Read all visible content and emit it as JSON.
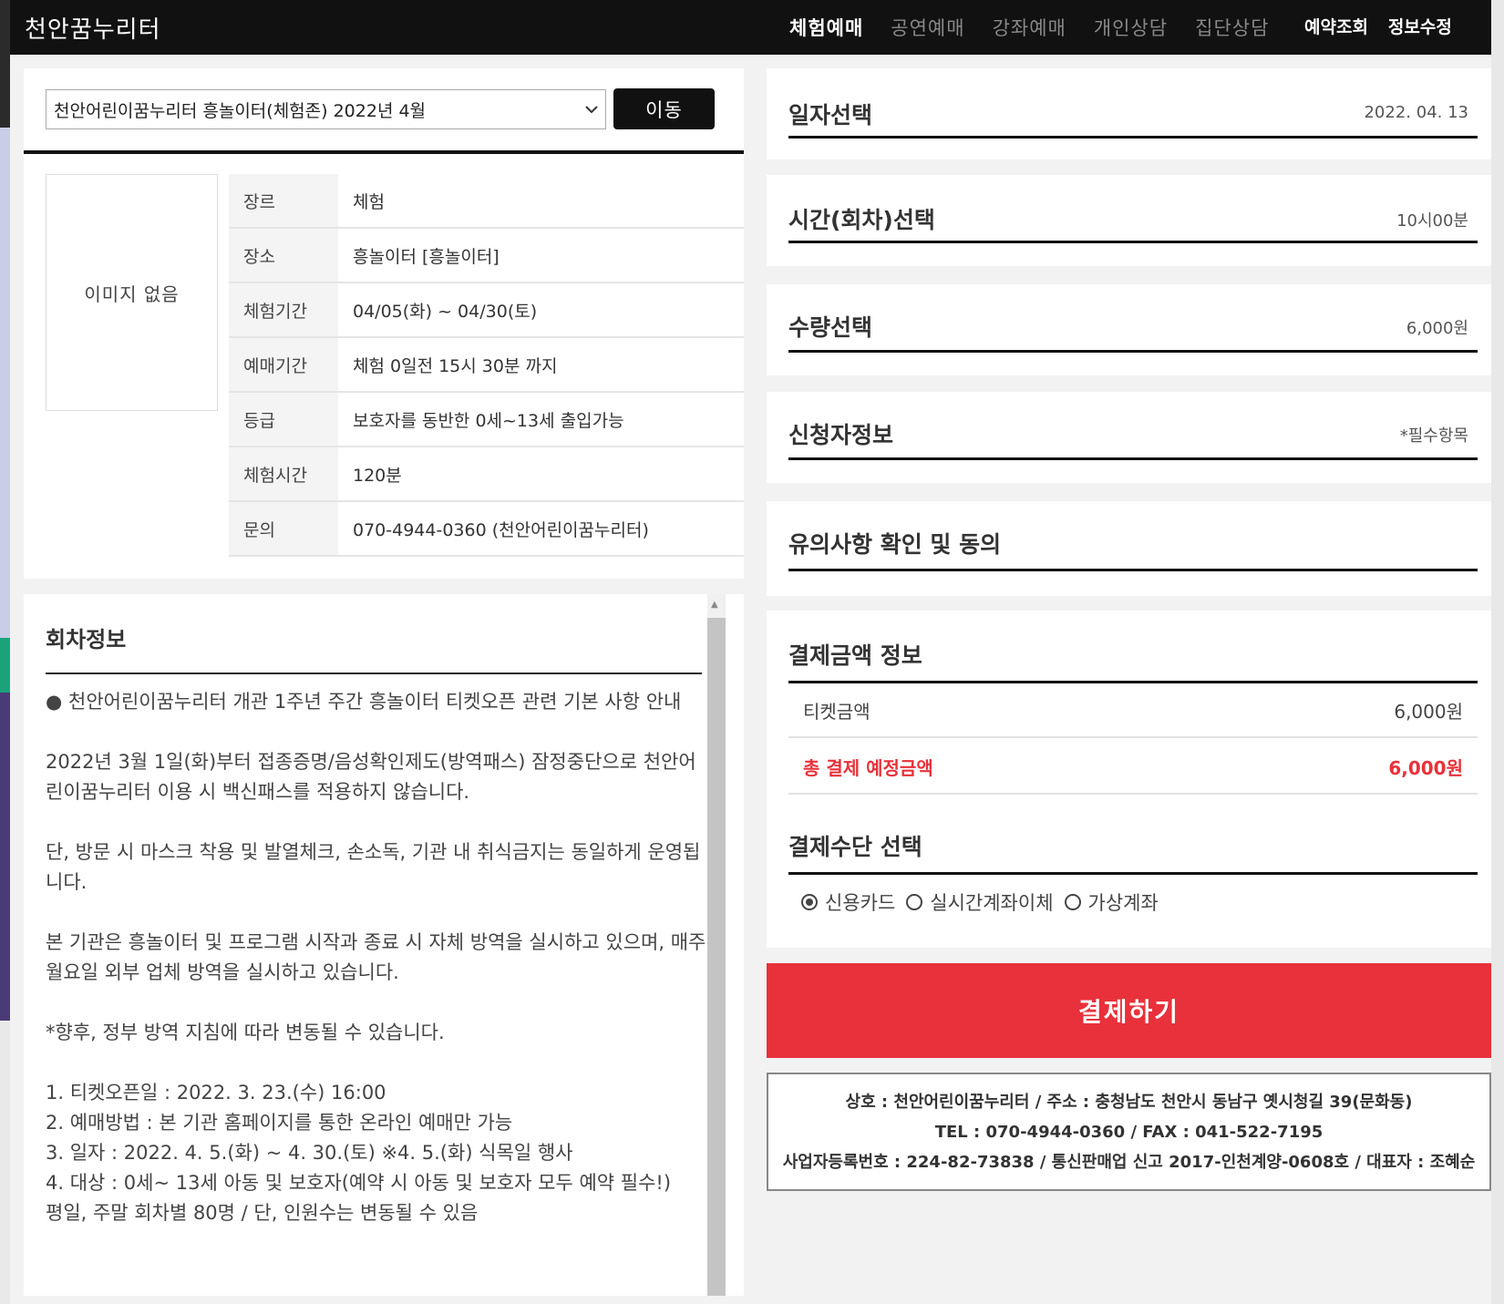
{
  "header": {
    "brand": "천안꿈누리터",
    "nav": [
      "체험예매",
      "공연예매",
      "강좌예매",
      "개인상담",
      "집단상담"
    ],
    "nav_right": [
      "예약조회",
      "정보수정"
    ]
  },
  "selector": {
    "selected": "천안어린이꿈누리터 흥놀이터(체험존) 2022년 4월",
    "button": "이동"
  },
  "no_image": "이미지 없음",
  "info": [
    {
      "k": "장르",
      "v": "체험"
    },
    {
      "k": "장소",
      "v": "흥놀이터 [흥놀이터]"
    },
    {
      "k": "체험기간",
      "v": "04/05(화) ~ 04/30(토)"
    },
    {
      "k": "예매기간",
      "v": "체험 0일전 15시 30분 까지"
    },
    {
      "k": "등급",
      "v": "보호자를 동반한 0세~13세 출입가능"
    },
    {
      "k": "체험시간",
      "v": "120분"
    },
    {
      "k": "문의",
      "v": "070-4944-0360 (천안어린이꿈누리터)"
    }
  ],
  "session": {
    "title": "회차정보",
    "p1": "● 천안어린이꿈누리터 개관 1주년 주간 흥놀이터 티켓오픈 관련 기본 사항 안내",
    "p2": "2022년 3월 1일(화)부터 접종증명/음성확인제도(방역패스) 잠정중단으로 천안어린이꿈누리터 이용 시 백신패스를 적용하지 않습니다.",
    "p3": "단, 방문 시 마스크 착용 및 발열체크, 손소독, 기관 내 취식금지는 동일하게 운영됩니다.",
    "p4": "본 기관은 흥놀이터 및 프로그램 시작과 종료 시 자체 방역을 실시하고 있으며, 매주 월요일 외부 업체 방역을 실시하고 있습니다.",
    "p5": "*향후, 정부 방역 지침에 따라 변동될 수 있습니다.",
    "l1": "1. 티켓오픈일 : 2022. 3. 23.(수) 16:00",
    "l2": "2. 예매방법 : 본 기관 홈페이지를 통한 온라인 예매만 가능",
    "l3": "3. 일자 : 2022. 4. 5.(화) ~ 4. 30.(토) ※4. 5.(화) 식목일 행사",
    "l4": "4. 대상 : 0세~ 13세 아동 및 보호자(예약 시 아동 및 보호자 모두 예약 필수!)",
    "l5": "평일, 주말 회차별 80명 / 단, 인원수는 변동될 수 있음"
  },
  "steps": {
    "date": {
      "title": "일자선택",
      "value": "2022. 04. 13"
    },
    "time": {
      "title": "시간(회차)선택",
      "value": "10시00분"
    },
    "qty": {
      "title": "수량선택",
      "value": "6,000원"
    },
    "applicant": {
      "title": "신청자정보",
      "value": "*필수항목"
    },
    "agree": {
      "title": "유의사항 확인 및 동의"
    }
  },
  "payment": {
    "title": "결제금액 정보",
    "ticket_label": "티켓금액",
    "ticket_value": "6,000원",
    "total_label": "총 결제 예정금액",
    "total_value": "6,000원",
    "method_title": "결제수단 선택",
    "methods": [
      "신용카드",
      "실시간계좌이체",
      "가상계좌"
    ],
    "selected_method": "신용카드",
    "pay_button": "결제하기"
  },
  "footer": {
    "line1": "상호 : 천안어린이꿈누리터 / 주소 : 충청남도 천안시 동남구 옛시청길 39(문화동)",
    "line2": "TEL : 070-4944-0360 / FAX : 041-522-7195",
    "line3": "사업자등록번호 : 224-82-73838 / 통신판매업 신고 2017-인천계양-0608호 / 대표자 : 조혜순"
  },
  "colors": {
    "accent": "#e8313a",
    "header_bg": "#111111"
  }
}
